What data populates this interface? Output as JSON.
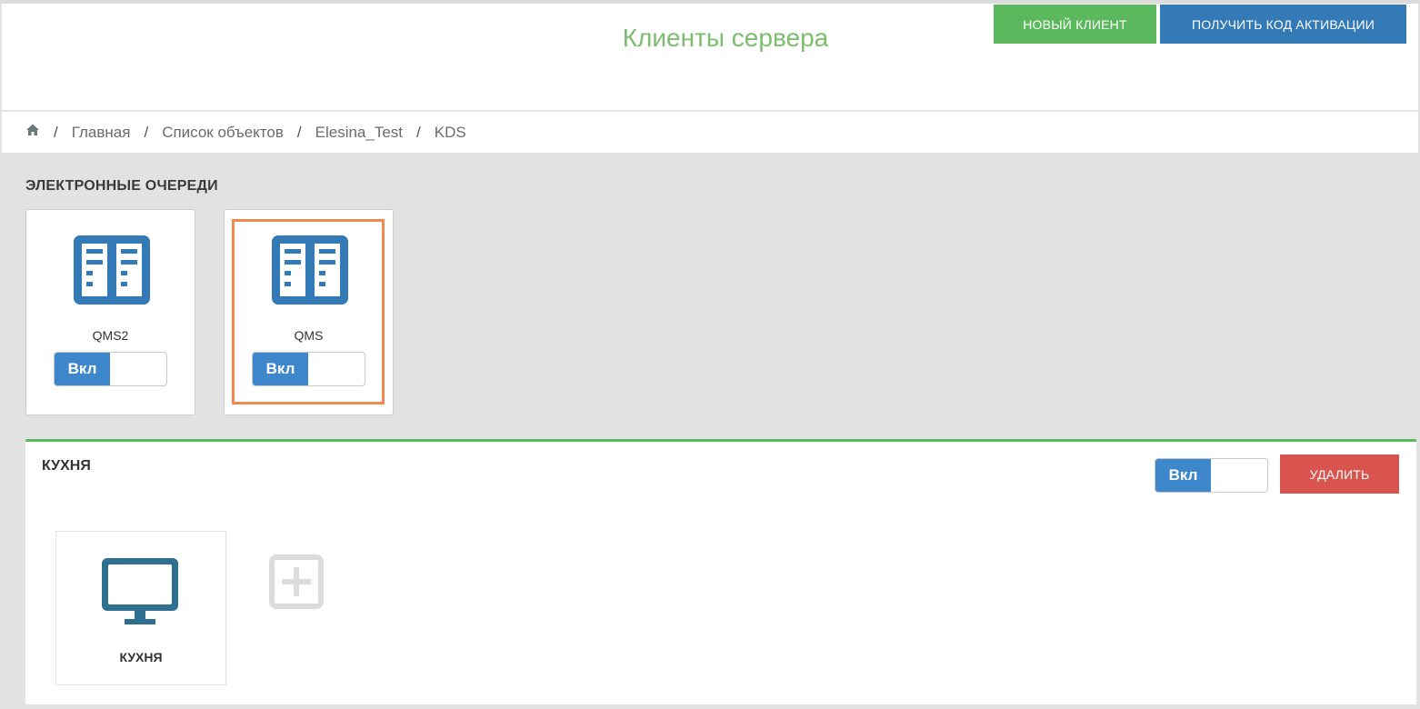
{
  "header": {
    "title": "Клиенты сервера",
    "new_client_button": "НОВЫЙ КЛИЕНТ",
    "get_activation_code_button": "ПОЛУЧИТЬ КОД АКТИВАЦИИ"
  },
  "breadcrumb": {
    "home_icon": "home-icon",
    "items": [
      "Главная",
      "Список объектов",
      "Elesina_Test",
      "KDS"
    ]
  },
  "queues_section": {
    "title": "ЭЛЕКТРОННЫЕ ОЧЕРЕДИ",
    "cards": [
      {
        "label": "QMS2",
        "toggle_label": "Вкл",
        "icon": "server-icon"
      },
      {
        "label": "QMS",
        "toggle_label": "Вкл",
        "icon": "server-icon"
      }
    ]
  },
  "kitchen_panel": {
    "title": "КУХНЯ",
    "toggle_label": "Вкл",
    "delete_button": "УДАЛИТЬ",
    "device": {
      "label": "КУХНЯ",
      "icon": "monitor-icon"
    },
    "add_icon": "add-icon"
  },
  "colors": {
    "title_green": "#7cbd6e",
    "btn_green": "#5cb85c",
    "btn_blue": "#337ab7",
    "btn_red": "#d9534f",
    "toggle_blue": "#3f87cc",
    "highlight_orange": "#f08a4b"
  }
}
